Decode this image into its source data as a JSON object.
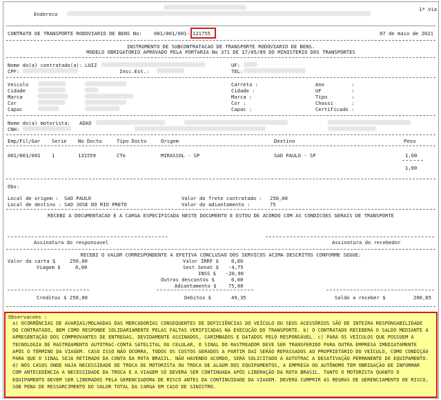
{
  "copy_label": "1ª Via",
  "header": {
    "endereco_label": "Endereco",
    "contract_label": "CONTRATO DE TRANSPORTE RODOVIARIO DE BENS No:",
    "contract_prefix": "001/001/001-",
    "contract_number": "121755",
    "date": "07 de maio de 2021"
  },
  "title": {
    "line1": "INSTRUMENTO DE SUBCONTRATACAO DE TRANSPORTE RODOVIARIO DE BENS.",
    "line2": "MODELO OBRIGATORIO APROVADO PELA PORTARIA No 371 DE 17/05/89 DO MINISTERIO DOS TRANSPORTES"
  },
  "contratado": {
    "name_label": "Nome do(a) contratado(a):",
    "name_value": "LUIZ",
    "uf_label": "UF:",
    "cpf_label": "CPF:",
    "insc_label": "Insc.Est.:",
    "tel_label": "TEL:"
  },
  "veiculo": {
    "left_labels": [
      "Veiculo",
      "Cidade",
      "Marca",
      "Cor",
      "Capac"
    ],
    "mid_labels": [
      "Carreta :",
      "Cidade  :",
      "Marca   :",
      "Cor     :",
      "Capac   :"
    ],
    "right_labels": [
      "Ano",
      "UF",
      "Tipo",
      "Chassi",
      "Certificado"
    ]
  },
  "motorista": {
    "name_label": "Nome do(a) motorista:",
    "name_value": "ADAO",
    "cnh_label": "CNH:"
  },
  "table": {
    "headers": [
      "Emp/Fil/Gar",
      "Serie",
      "No Docto",
      "Tipo Docto",
      "Origem",
      "Destino",
      "Peso"
    ],
    "rows": [
      [
        "001/001/001",
        "1",
        "131559",
        "CTe",
        "MIRASSOL - SP",
        "SAO PAULO - SP",
        "1,00"
      ]
    ],
    "total_weight": "1,00"
  },
  "obs_label": "Obs:",
  "local": {
    "origem_label": "Local de origem  :",
    "origem_value": "SAO PAULO",
    "destino_label": "Local de destino :",
    "destino_value": "SAO JOSE DO RIO PRETO",
    "frete_label": "Valor do frete contratado :",
    "frete_value": "250,00",
    "adiant_label": "Valor do adiantamento     :",
    "adiant_value": "75"
  },
  "receipt_statement": "RECEBI A DOCUMENTACAO E A CARGA ESPECIFICADA NESTE DOCUMENTO E ESTOU DE ACORDO COM AS CONDICOES GERAIS DE TRANSPORTE",
  "sign_responsavel": "Assinatura do responsavel",
  "sign_recebedor": "Assinatura do recebedor",
  "payment_statement": "RECEBI O VALOR CORRESPONDENTE A EFETIVA CONCLUSAO DOS SERVICOS ACIMA DESCRITOS CONFORME SEGUE:",
  "payment": {
    "valor_carta_label": "Valor da  carta  $",
    "valor_carta_value": "250,00",
    "viagem_label": "Viagem  $",
    "viagem_value": "0,00",
    "irrf_label": "Valor IRRF  $",
    "irrf_value": "0,00",
    "senat_label": "Sest Senat  $",
    "senat_value": "-4,75",
    "inss_label": "INSS  $",
    "inss_value": "-20,90",
    "outros_label": "Outros descontos  $",
    "outros_value": "0,00",
    "adiant_label": "Adiantamento  $",
    "adiant_value": "75,00",
    "creditos_label": "Creditos  $",
    "creditos_value": "250,00",
    "debitos_label": "Debitos  $",
    "debitos_value": "49,35",
    "saldo_label": "Saldo a receber  $",
    "saldo_value": "200,65"
  },
  "observacoes": {
    "label": "Observacoes :",
    "text": "a) OCORRÊNCIAS DE AVARIAS/MOLHADAS DAS MERCADORIAS CONSEQUENTES DE DEFICIÊNCIAS DO VEÍCULO OU SEUS ACESSÓRIOS SÃO DE INTEIRA RESPONSABILIDADE DO CONTRATADO, BEM COMO RESPONDE SOLIDARIAMENTE PELAS FALTAS VERIFICADAS NA EXECUÇÃO DO TRANSPORTE. b) O CONTRATADO RECEBERÁ O SALDO MEDIANTE A APRESENTAÇÃO DOS COMPROVANTES DE ENTREGAS, DEVIDAMENTE ASSINADOS, CARIMBADOS E DATADOS PELO RESPONSÁVEL. c) PARA OS VEÍCULOS QUE POSSUEM A TECNOLOGIA DE RASTREAMENTO AUTOTRAC-CONTA SATELITAL OU CELULAR, O SINAL DO RASTREADOR DEVE SER TRANSFERIDO PARA OUTRA EMPRESA IMEDIATAMENTE APÓS O TÉRMINO DA VIAGEM. CASO ISSO NÃO OCORRA, TODOS OS CUSTOS GERADOS A PARTIR DAÍ SERÃO REPASSADOS AO PROPRIETÁRIO DO VEÍCULO, COMO CONDIÇÃO PARA QUE O SINAL SEJA RETIRADO DA CONTA DA ROTA BRASIL. NÃO HAVENDO ACORDO, SERÁ SOLICITADO À AUTOTRAC A DESATIVAÇÃO PERMANENTE DO EQUIPAMENTO. d) NOS CASOS ONDE HAJA NECESSIDADE DE TROCA DE MOTORISTA OU TROCA DE ALGUM DOS EQUIPAMENTOS, A EMPRESA OU AUTÔNOMO TEM OBRIGAÇÃO DE INFORMAR COM ANTECEDÊNCIA A NECESSIDADE DA TROCA E A VIAGEM SÓ DEVERÁ SER CONTINUADA APÓS LIBERAÇÃO DA ROTA BRASIL. TANTO O MOTORISTA QUANTO O EQUIPAMENTO DEVEM SER LIBERADOS PELA GERENCIADORA DE RISCO ANTES DA CONTINUIDADE DA VIAGEM. DEVERÁ CUMPRIR AS REGRAS DE GERENCIAMENTO DE RISCO, SOB PENA DE RESSARCIMENTO DO VALOR TOTAL DA CARGA EM CASO DE SINISTRO."
  }
}
